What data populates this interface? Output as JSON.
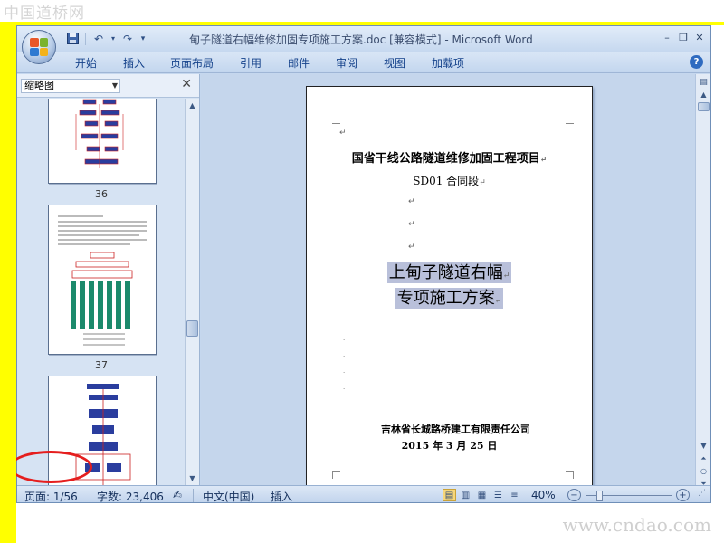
{
  "watermarks": {
    "top": "中国道桥网",
    "bottom": "www.cndao.com"
  },
  "window": {
    "title": "甸子隧道右幅维修加固专项施工方案.doc [兼容模式] - Microsoft Word",
    "controls": {
      "minimize": "–",
      "restore": "❐",
      "close": "✕"
    }
  },
  "quick_access": {
    "save_icon": "save-icon",
    "undo_icon": "undo-icon",
    "redo_icon": "redo-icon",
    "customize": "▾"
  },
  "ribbon_tabs": [
    "开始",
    "插入",
    "页面布局",
    "引用",
    "邮件",
    "审阅",
    "视图",
    "加载项"
  ],
  "help": "?",
  "nav_pane": {
    "view_select": "缩略图",
    "close": "✕",
    "thumbnails": [
      {
        "page": "36"
      },
      {
        "page": "37"
      }
    ]
  },
  "document": {
    "lines": {
      "project": "国省干线公路隧道维修加固工程项目",
      "section": "SD01 合同段",
      "title_1": "上甸子隧道右幅",
      "title_2": "专项施工方案",
      "company": "吉林省长城路桥建工有限责任公司",
      "date": "2015 年 3 月 25 日"
    },
    "para_mark": "↵"
  },
  "status_bar": {
    "page": "页面: 1/56",
    "words": "字数: 23,406",
    "language": "中文(中国)",
    "mode": "插入",
    "zoom": "40%"
  },
  "colors": {
    "annotation_circle": "#e51e1e",
    "highlight": "#b9c0da",
    "frame": "#ffff00",
    "ribbon_text": "#15428b"
  }
}
